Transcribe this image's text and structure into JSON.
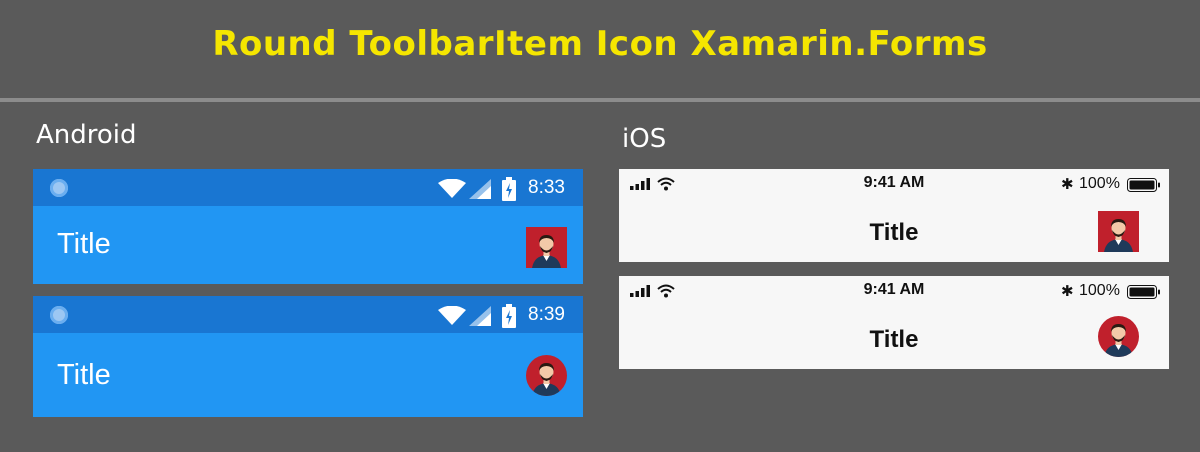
{
  "header": {
    "title": "Round ToolbarItem Icon Xamarin.Forms"
  },
  "android": {
    "label": "Android",
    "screens": [
      {
        "time": "8:33",
        "title": "Title",
        "icon_shape": "square"
      },
      {
        "time": "8:39",
        "title": "Title",
        "icon_shape": "round"
      }
    ]
  },
  "ios": {
    "label": "iOS",
    "screens": [
      {
        "time": "9:41 AM",
        "battery": "100%",
        "title": "Title",
        "icon_shape": "square"
      },
      {
        "time": "9:41 AM",
        "battery": "100%",
        "title": "Title",
        "icon_shape": "round"
      }
    ]
  },
  "colors": {
    "background": "#5a5a5a",
    "title_yellow": "#f5e600",
    "android_toolbar": "#2196f3",
    "android_statusbar": "#1976d2",
    "ios_bar": "#f7f7f7",
    "avatar_bg": "#c0202c"
  },
  "icons": {
    "avatar": "avatar-icon",
    "wifi": "wifi-icon",
    "signal": "signal-icon",
    "battery": "battery-icon",
    "bluetooth": "bluetooth-icon",
    "notification": "notification-icon"
  }
}
